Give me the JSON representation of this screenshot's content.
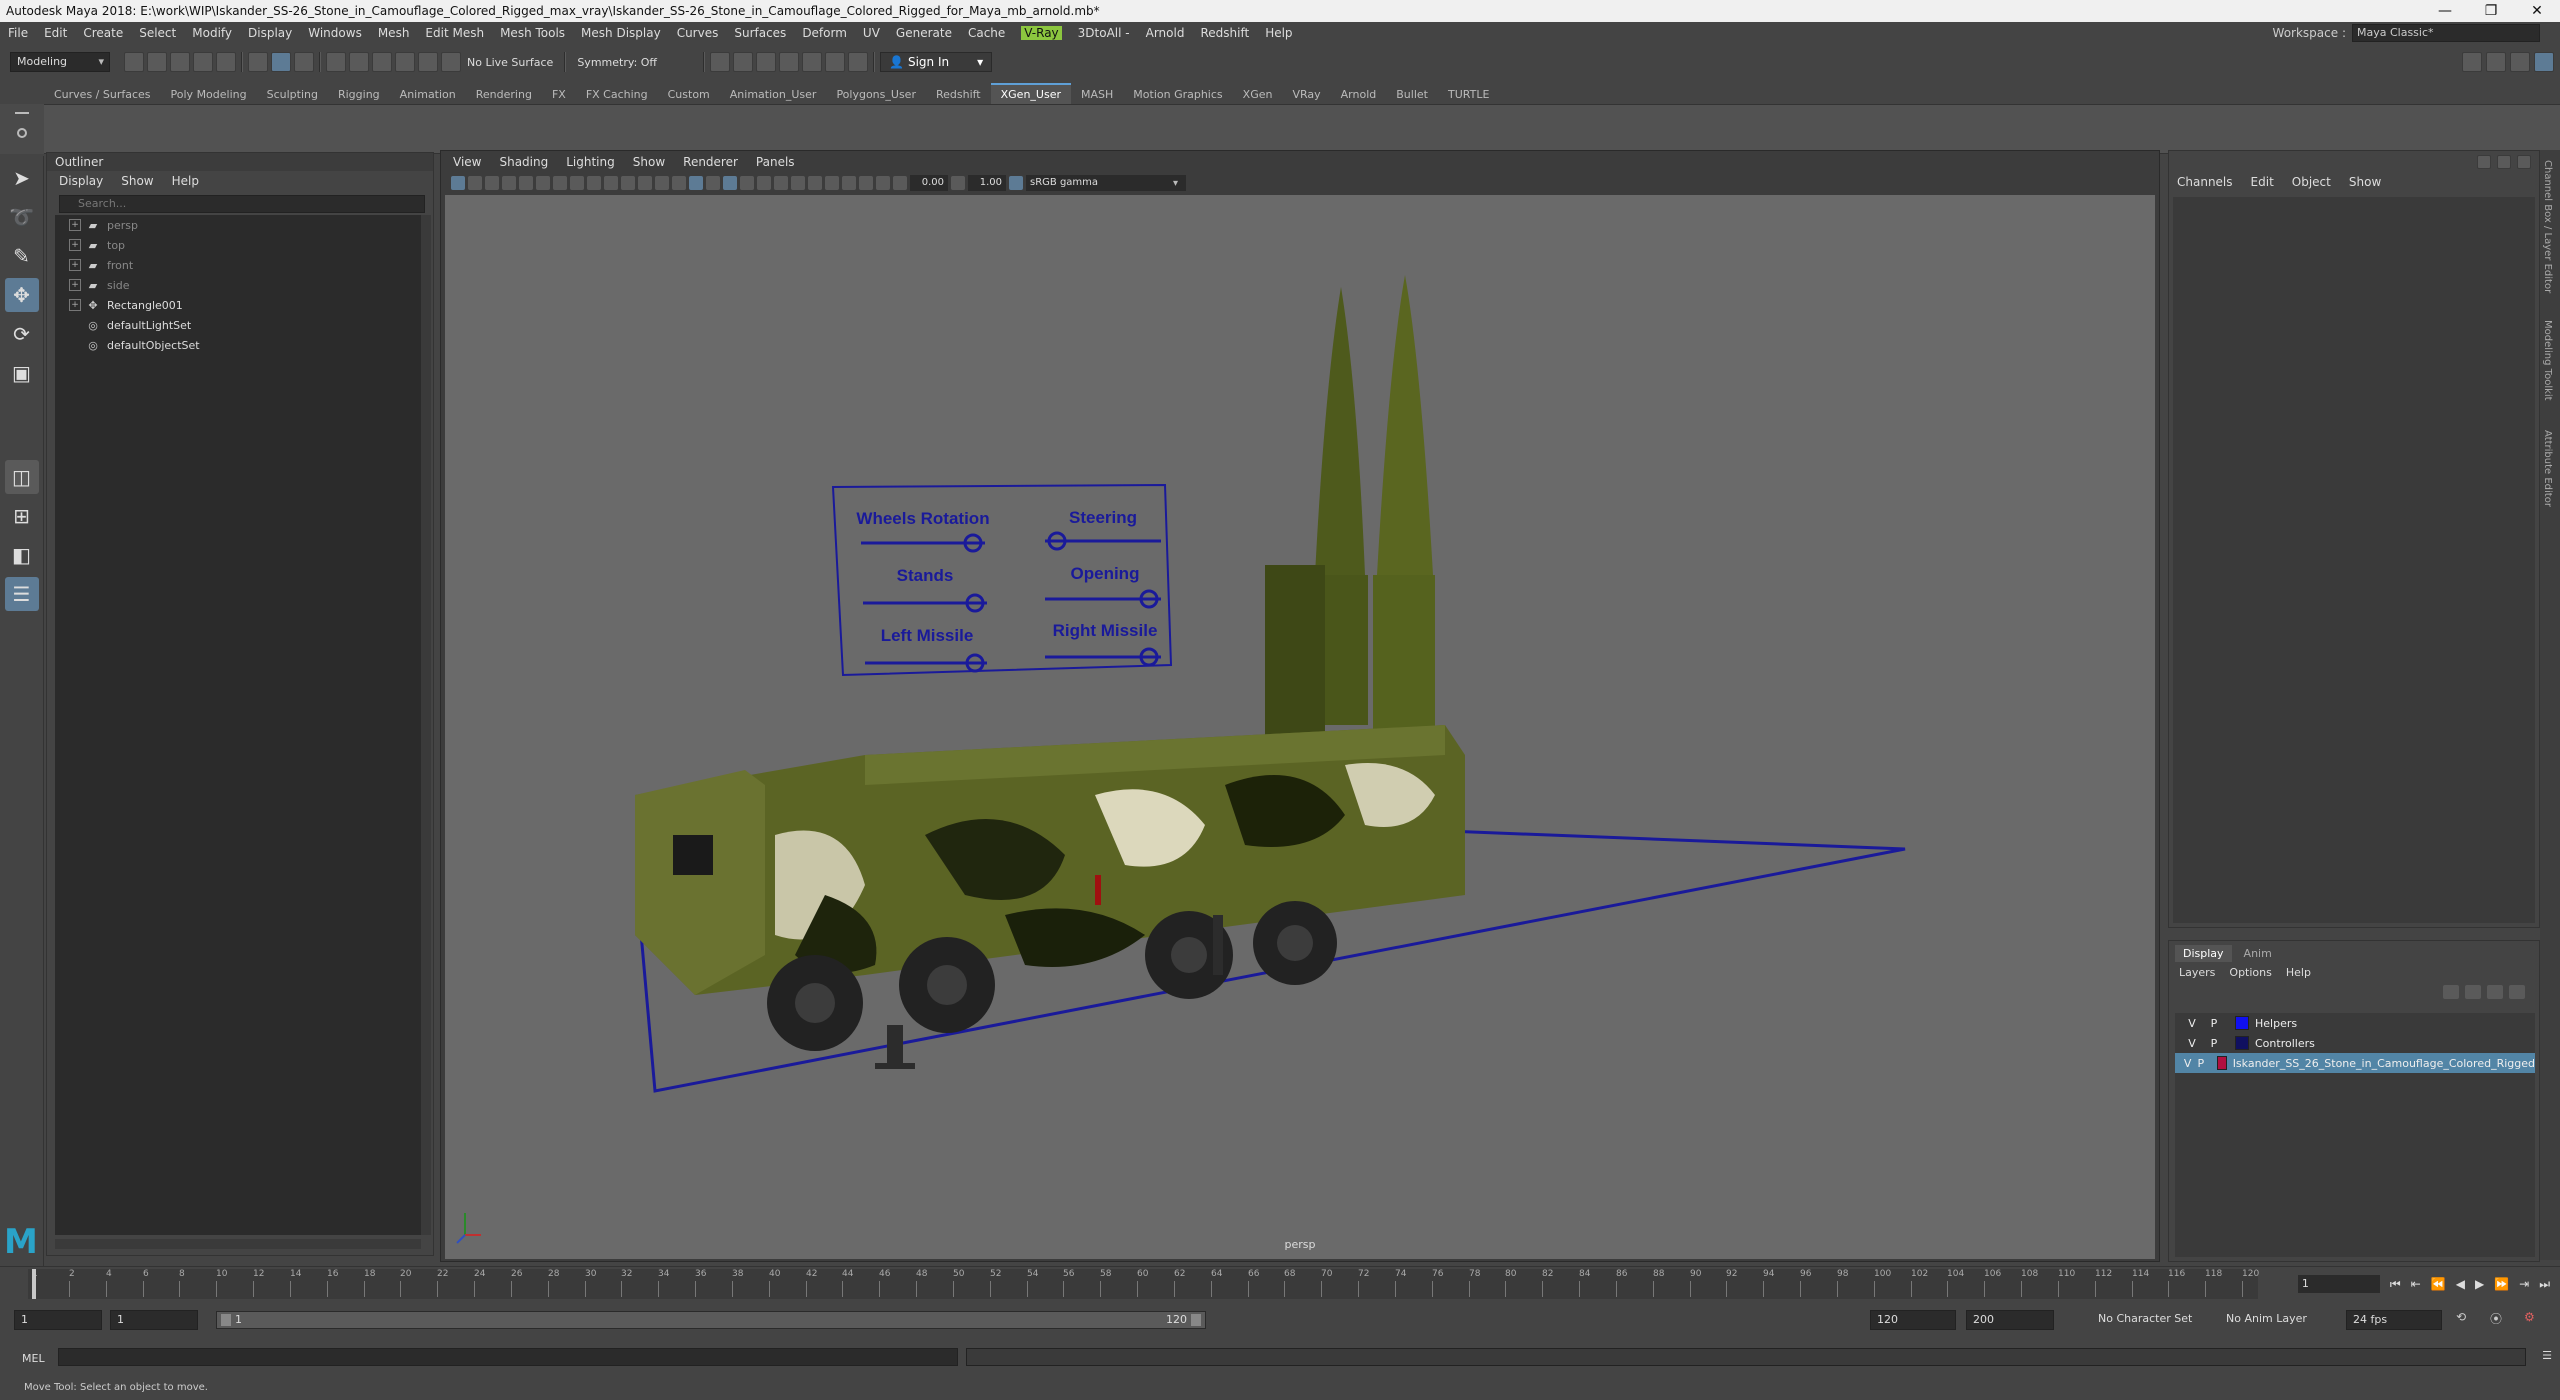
{
  "window": {
    "title": "Autodesk Maya 2018: E:\\work\\WIP\\Iskander_SS-26_Stone_in_Camouflage_Colored_Rigged_max_vray\\Iskander_SS-26_Stone_in_Camouflage_Colored_Rigged_for_Maya_mb_arnold.mb*",
    "minimize": "—",
    "restore": "❐",
    "close": "✕"
  },
  "menubar": {
    "items": [
      "File",
      "Edit",
      "Create",
      "Select",
      "Modify",
      "Display",
      "Windows",
      "Mesh",
      "Edit Mesh",
      "Mesh Tools",
      "Mesh Display",
      "Curves",
      "Surfaces",
      "Deform",
      "UV",
      "Generate",
      "Cache",
      "V-Ray",
      "3DtoAll -",
      "Arnold",
      "Redshift",
      "Help"
    ],
    "workspace_label": "Workspace :",
    "workspace_value": "Maya Classic*"
  },
  "statusline": {
    "mode": "Modeling",
    "live_surface": "No Live Surface",
    "symmetry": "Symmetry: Off",
    "sign_in": "Sign In"
  },
  "shelf": {
    "tabs": [
      "Curves / Surfaces",
      "Poly Modeling",
      "Sculpting",
      "Rigging",
      "Animation",
      "Rendering",
      "FX",
      "FX Caching",
      "Custom",
      "Animation_User",
      "Polygons_User",
      "Redshift",
      "XGen_User",
      "MASH",
      "Motion Graphics",
      "XGen",
      "VRay",
      "Arnold",
      "Bullet",
      "TURTLE"
    ],
    "active_tab": "XGen_User"
  },
  "outliner": {
    "title": "Outliner",
    "menu": [
      "Display",
      "Show",
      "Help"
    ],
    "search_placeholder": "Search...",
    "items": [
      {
        "label": "persp",
        "type": "camera",
        "dim": true
      },
      {
        "label": "top",
        "type": "camera",
        "dim": true
      },
      {
        "label": "front",
        "type": "camera",
        "dim": true
      },
      {
        "label": "side",
        "type": "camera",
        "dim": true
      },
      {
        "label": "Rectangle001",
        "type": "transform",
        "dim": false
      },
      {
        "label": "defaultLightSet",
        "type": "set",
        "dim": false
      },
      {
        "label": "defaultObjectSet",
        "type": "set",
        "dim": false
      }
    ]
  },
  "viewport": {
    "menu": [
      "View",
      "Shading",
      "Lighting",
      "Show",
      "Renderer",
      "Panels"
    ],
    "exposure": "0.00",
    "gamma": "1.00",
    "color_space": "sRGB gamma",
    "camera_name": "persp",
    "control_panel": {
      "labels": [
        "Wheels Rotation",
        "Steering",
        "Stands",
        "Opening",
        "Left Missile",
        "Right Missile"
      ]
    }
  },
  "channelbox": {
    "menu": [
      "Channels",
      "Edit",
      "Object",
      "Show"
    ],
    "side_tabs": [
      "Channel Box / Layer Editor",
      "Modeling Toolkit",
      "Attribute Editor"
    ]
  },
  "layers": {
    "tabs": [
      "Display",
      "Anim"
    ],
    "active_tab": "Display",
    "menu": [
      "Layers",
      "Options",
      "Help"
    ],
    "rows": [
      {
        "v": "V",
        "p": "P",
        "color": "#1010f0",
        "name": "Helpers",
        "selected": false
      },
      {
        "v": "V",
        "p": "P",
        "color": "#101060",
        "name": "Controllers",
        "selected": false
      },
      {
        "v": "V",
        "p": "P",
        "color": "#b01040",
        "name": "Iskander_SS_26_Stone_in_Camouflage_Colored_Rigged",
        "selected": true
      }
    ]
  },
  "timeslider": {
    "ticks": [
      "1",
      "2",
      "4",
      "6",
      "8",
      "10",
      "12",
      "14",
      "16",
      "18",
      "20",
      "22",
      "24",
      "26",
      "28",
      "30",
      "32",
      "34",
      "36",
      "38",
      "40",
      "42",
      "44",
      "46",
      "48",
      "50",
      "52",
      "54",
      "56",
      "58",
      "60",
      "62",
      "64",
      "66",
      "68",
      "70",
      "72",
      "74",
      "76",
      "78",
      "80",
      "82",
      "84",
      "86",
      "88",
      "90",
      "92",
      "94",
      "96",
      "98",
      "100",
      "102",
      "104",
      "106",
      "108",
      "110",
      "112",
      "114",
      "116",
      "118",
      "120"
    ],
    "current_frame": "1"
  },
  "rangeslider": {
    "start_field": "1",
    "start_field2": "1",
    "range_start": "1",
    "range_end": "120",
    "end_field": "120",
    "end_field2": "200",
    "character_set": "No Character Set",
    "anim_layer": "No Anim Layer",
    "fps": "24 fps"
  },
  "cmdline": {
    "label": "MEL"
  },
  "helpline": {
    "text": "Move Tool: Select an object to move."
  },
  "colors": {
    "ui_bg": "#444444",
    "viewport_bg": "#6a6a6a",
    "accent": "#5285a6",
    "control_blue": "#1a1a9a"
  }
}
